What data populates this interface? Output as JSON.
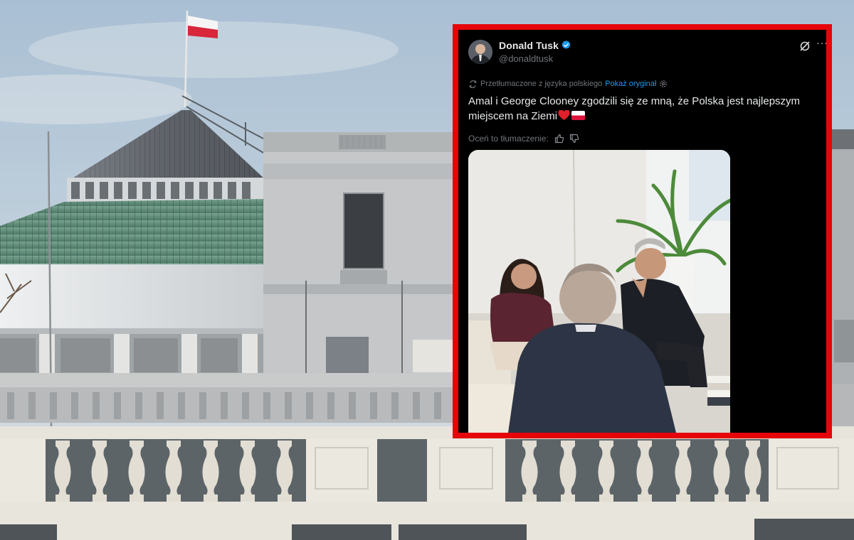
{
  "tweet": {
    "author_name": "Donald Tusk",
    "author_handle": "@donaldtusk",
    "translation_note": "Przetłumaczone z języka polskiego",
    "show_original": "Pokaż oryginał",
    "text_line1": "Amal i George Clooney zgodzili się ze mną, że Polska jest najlepszym",
    "text_line2": "miejscem na Ziemi",
    "rate_translation": "Oceń to tłumaczenie:"
  },
  "icons": {
    "verified": "verified-badge-icon",
    "grok": "grok-icon",
    "more": "more-icon",
    "translate": "translate-icon",
    "settings": "gear-icon",
    "thumbs_up": "thumbs-up-icon",
    "thumbs_down": "thumbs-down-icon",
    "heart": "red-heart-icon",
    "flag": "poland-flag-icon"
  },
  "colors": {
    "frame_border": "#e5050a",
    "tweet_background": "#000000",
    "link_blue": "#1d9bf0",
    "verified_blue": "#1d9bf0",
    "muted_text": "#71767b",
    "heart_red": "#e0202a"
  }
}
